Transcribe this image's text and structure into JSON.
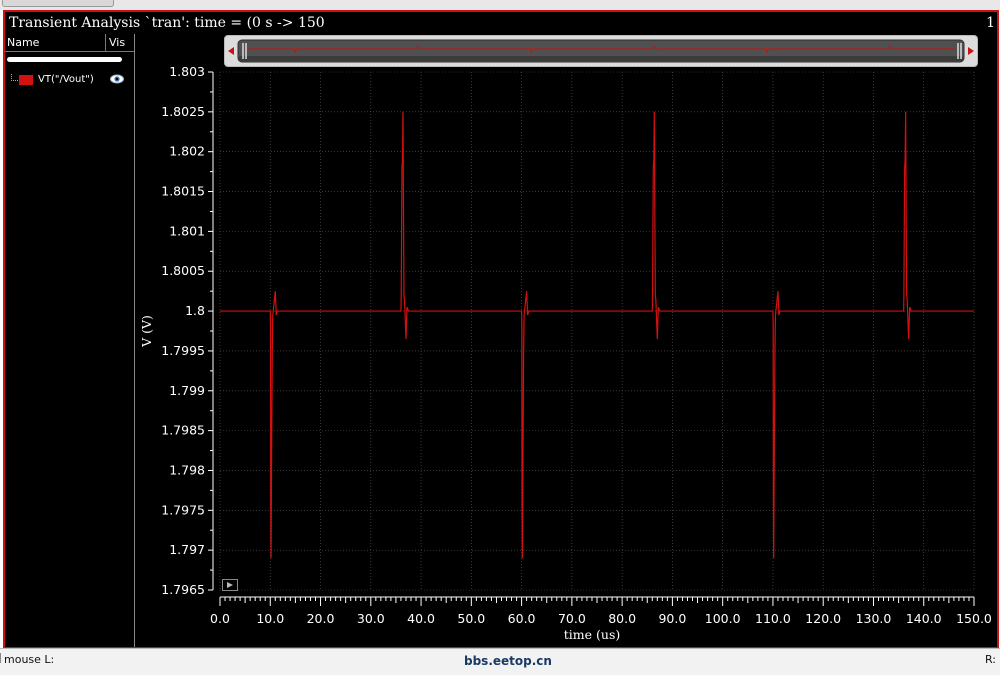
{
  "window": {
    "title": "Transient Analysis `tran': time = (0 s -> 150",
    "panel_number": "1"
  },
  "panel": {
    "col_name": "Name",
    "col_vis": "Vis",
    "signals": [
      {
        "label": "VT(\"/Vout\")",
        "color": "#d41111",
        "visible": true
      }
    ]
  },
  "status": {
    "mouse_left": "mouse L:",
    "right_label": "R:",
    "watermark": "bbs.eetop.cn"
  },
  "colors": {
    "trace": "#d41111",
    "background": "#000000",
    "frame": "#cc1111",
    "grid": "#5a5a5a",
    "axis_text": "#ffffff"
  },
  "chart_data": {
    "type": "line",
    "title": "",
    "xlabel": "time (us)",
    "ylabel": "V (V)",
    "xlim": [
      0,
      150
    ],
    "ylim": [
      1.7965,
      1.803
    ],
    "grid": true,
    "x_ticks": [
      "0.0",
      "10.0",
      "20.0",
      "30.0",
      "40.0",
      "50.0",
      "60.0",
      "70.0",
      "80.0",
      "90.0",
      "100.0",
      "110.0",
      "120.0",
      "130.0",
      "140.0",
      "150.0"
    ],
    "y_ticks": [
      "1.803",
      "1.8025",
      "1.802",
      "1.8015",
      "1.801",
      "1.8005",
      "1.8",
      "1.7995",
      "1.799",
      "1.7985",
      "1.798",
      "1.7975",
      "1.797",
      "1.7965"
    ],
    "series": [
      {
        "name": "VT(\"/Vout\")",
        "points": [
          [
            0,
            1.8
          ],
          [
            10,
            1.8
          ],
          [
            10.05,
            1.7998
          ],
          [
            10.1,
            1.7975
          ],
          [
            10.15,
            1.7969
          ],
          [
            10.2,
            1.7975
          ],
          [
            10.3,
            1.7985
          ],
          [
            10.4,
            1.7995
          ],
          [
            10.5,
            1.79995
          ],
          [
            11,
            1.80025
          ],
          [
            11.2,
            1.79995
          ],
          [
            11.4,
            1.8
          ],
          [
            36,
            1.8
          ],
          [
            36.05,
            1.8002
          ],
          [
            36.2,
            1.8018
          ],
          [
            36.3,
            1.8019
          ],
          [
            36.4,
            1.8025
          ],
          [
            36.5,
            1.8013
          ],
          [
            36.6,
            1.8002
          ],
          [
            36.7,
            1.80015
          ],
          [
            37,
            1.79965
          ],
          [
            37.2,
            1.80005
          ],
          [
            37.5,
            1.8
          ],
          [
            60,
            1.8
          ],
          [
            60.05,
            1.7998
          ],
          [
            60.1,
            1.7975
          ],
          [
            60.15,
            1.7969
          ],
          [
            60.2,
            1.7975
          ],
          [
            60.3,
            1.7985
          ],
          [
            60.4,
            1.7995
          ],
          [
            60.5,
            1.79995
          ],
          [
            61,
            1.80025
          ],
          [
            61.2,
            1.79995
          ],
          [
            61.4,
            1.8
          ],
          [
            86,
            1.8
          ],
          [
            86.05,
            1.8002
          ],
          [
            86.2,
            1.8018
          ],
          [
            86.3,
            1.8019
          ],
          [
            86.4,
            1.8025
          ],
          [
            86.5,
            1.8013
          ],
          [
            86.6,
            1.8002
          ],
          [
            86.7,
            1.80015
          ],
          [
            87,
            1.79965
          ],
          [
            87.2,
            1.80005
          ],
          [
            87.5,
            1.8
          ],
          [
            110,
            1.8
          ],
          [
            110.05,
            1.7998
          ],
          [
            110.1,
            1.7975
          ],
          [
            110.15,
            1.7969
          ],
          [
            110.2,
            1.7975
          ],
          [
            110.3,
            1.7985
          ],
          [
            110.4,
            1.7995
          ],
          [
            110.5,
            1.79995
          ],
          [
            111,
            1.80025
          ],
          [
            111.2,
            1.79995
          ],
          [
            111.4,
            1.8
          ],
          [
            136,
            1.8
          ],
          [
            136.05,
            1.8002
          ],
          [
            136.2,
            1.8018
          ],
          [
            136.3,
            1.8019
          ],
          [
            136.4,
            1.8025
          ],
          [
            136.5,
            1.8013
          ],
          [
            136.6,
            1.8002
          ],
          [
            136.7,
            1.80015
          ],
          [
            137,
            1.79965
          ],
          [
            137.2,
            1.80005
          ],
          [
            137.5,
            1.8
          ],
          [
            150,
            1.8
          ]
        ]
      }
    ]
  }
}
